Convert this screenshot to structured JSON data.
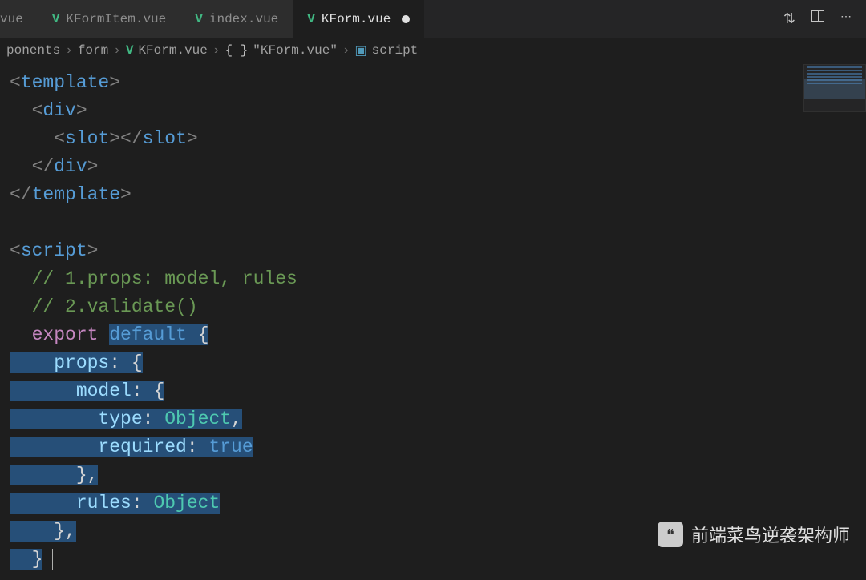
{
  "tabs": [
    {
      "label": "vue",
      "truncated": true
    },
    {
      "label": "KFormItem.vue"
    },
    {
      "label": "index.vue"
    },
    {
      "label": "KForm.vue",
      "active": true,
      "dirty": true
    }
  ],
  "breadcrumb": {
    "items": [
      {
        "label": "ponents",
        "icon": null
      },
      {
        "label": "form",
        "icon": null
      },
      {
        "label": "KForm.vue",
        "icon": "vue"
      },
      {
        "label": "\"KForm.vue\"",
        "icon": "brace"
      },
      {
        "label": "script",
        "icon": "cube"
      }
    ]
  },
  "code": {
    "lines": [
      [
        {
          "t": "<",
          "c": "bracket"
        },
        {
          "t": "template",
          "c": "tag"
        },
        {
          "t": ">",
          "c": "bracket"
        }
      ],
      [
        {
          "t": "  ",
          "c": "punc"
        },
        {
          "t": "<",
          "c": "bracket"
        },
        {
          "t": "div",
          "c": "tag"
        },
        {
          "t": ">",
          "c": "bracket"
        }
      ],
      [
        {
          "t": "    ",
          "c": "punc"
        },
        {
          "t": "<",
          "c": "bracket"
        },
        {
          "t": "slot",
          "c": "tag"
        },
        {
          "t": "></",
          "c": "bracket"
        },
        {
          "t": "slot",
          "c": "tag"
        },
        {
          "t": ">",
          "c": "bracket"
        }
      ],
      [
        {
          "t": "  ",
          "c": "punc"
        },
        {
          "t": "</",
          "c": "bracket"
        },
        {
          "t": "div",
          "c": "tag"
        },
        {
          "t": ">",
          "c": "bracket"
        }
      ],
      [
        {
          "t": "</",
          "c": "bracket"
        },
        {
          "t": "template",
          "c": "tag"
        },
        {
          "t": ">",
          "c": "bracket"
        }
      ],
      [],
      [
        {
          "t": "<",
          "c": "bracket"
        },
        {
          "t": "script",
          "c": "tag"
        },
        {
          "t": ">",
          "c": "bracket"
        }
      ],
      [
        {
          "t": "  ",
          "c": "punc"
        },
        {
          "t": "// 1.props: model, rules",
          "c": "comment"
        }
      ],
      [
        {
          "t": "  ",
          "c": "punc"
        },
        {
          "t": "// 2.validate()",
          "c": "comment"
        }
      ],
      [
        {
          "t": "  ",
          "c": "punc"
        },
        {
          "t": "export",
          "c": "keyword"
        },
        {
          "t": " ",
          "c": "punc"
        },
        {
          "t": "default",
          "c": "keyword2",
          "sel": true
        },
        {
          "t": " {",
          "c": "punc",
          "sel": true
        }
      ],
      [
        {
          "t": "    ",
          "c": "punc",
          "sel": true
        },
        {
          "t": "props",
          "c": "prop",
          "sel": true
        },
        {
          "t": ": {",
          "c": "punc",
          "sel": true
        }
      ],
      [
        {
          "t": "      ",
          "c": "punc",
          "sel": true
        },
        {
          "t": "model",
          "c": "prop",
          "sel": true
        },
        {
          "t": ": {",
          "c": "punc",
          "sel": true
        }
      ],
      [
        {
          "t": "        ",
          "c": "punc",
          "sel": true
        },
        {
          "t": "type",
          "c": "prop",
          "sel": true
        },
        {
          "t": ": ",
          "c": "punc",
          "sel": true
        },
        {
          "t": "Object",
          "c": "type",
          "sel": true
        },
        {
          "t": ",",
          "c": "punc",
          "sel": true
        }
      ],
      [
        {
          "t": "        ",
          "c": "punc",
          "sel": true
        },
        {
          "t": "required",
          "c": "prop",
          "sel": true
        },
        {
          "t": ": ",
          "c": "punc",
          "sel": true
        },
        {
          "t": "true",
          "c": "bool",
          "sel": true
        }
      ],
      [
        {
          "t": "      ",
          "c": "punc",
          "sel": true
        },
        {
          "t": "},",
          "c": "punc",
          "sel": true
        }
      ],
      [
        {
          "t": "      ",
          "c": "punc",
          "sel": true
        },
        {
          "t": "rules",
          "c": "prop",
          "sel": true
        },
        {
          "t": ": ",
          "c": "punc",
          "sel": true
        },
        {
          "t": "Object",
          "c": "type",
          "sel": true
        }
      ],
      [
        {
          "t": "    ",
          "c": "punc",
          "sel": true
        },
        {
          "t": "},",
          "c": "punc",
          "sel": true
        }
      ],
      [
        {
          "t": "  ",
          "c": "punc",
          "sel": true
        },
        {
          "t": "}",
          "c": "punc",
          "sel": true
        }
      ]
    ]
  },
  "watermark": {
    "text": "前端菜鸟逆袭架构师"
  }
}
